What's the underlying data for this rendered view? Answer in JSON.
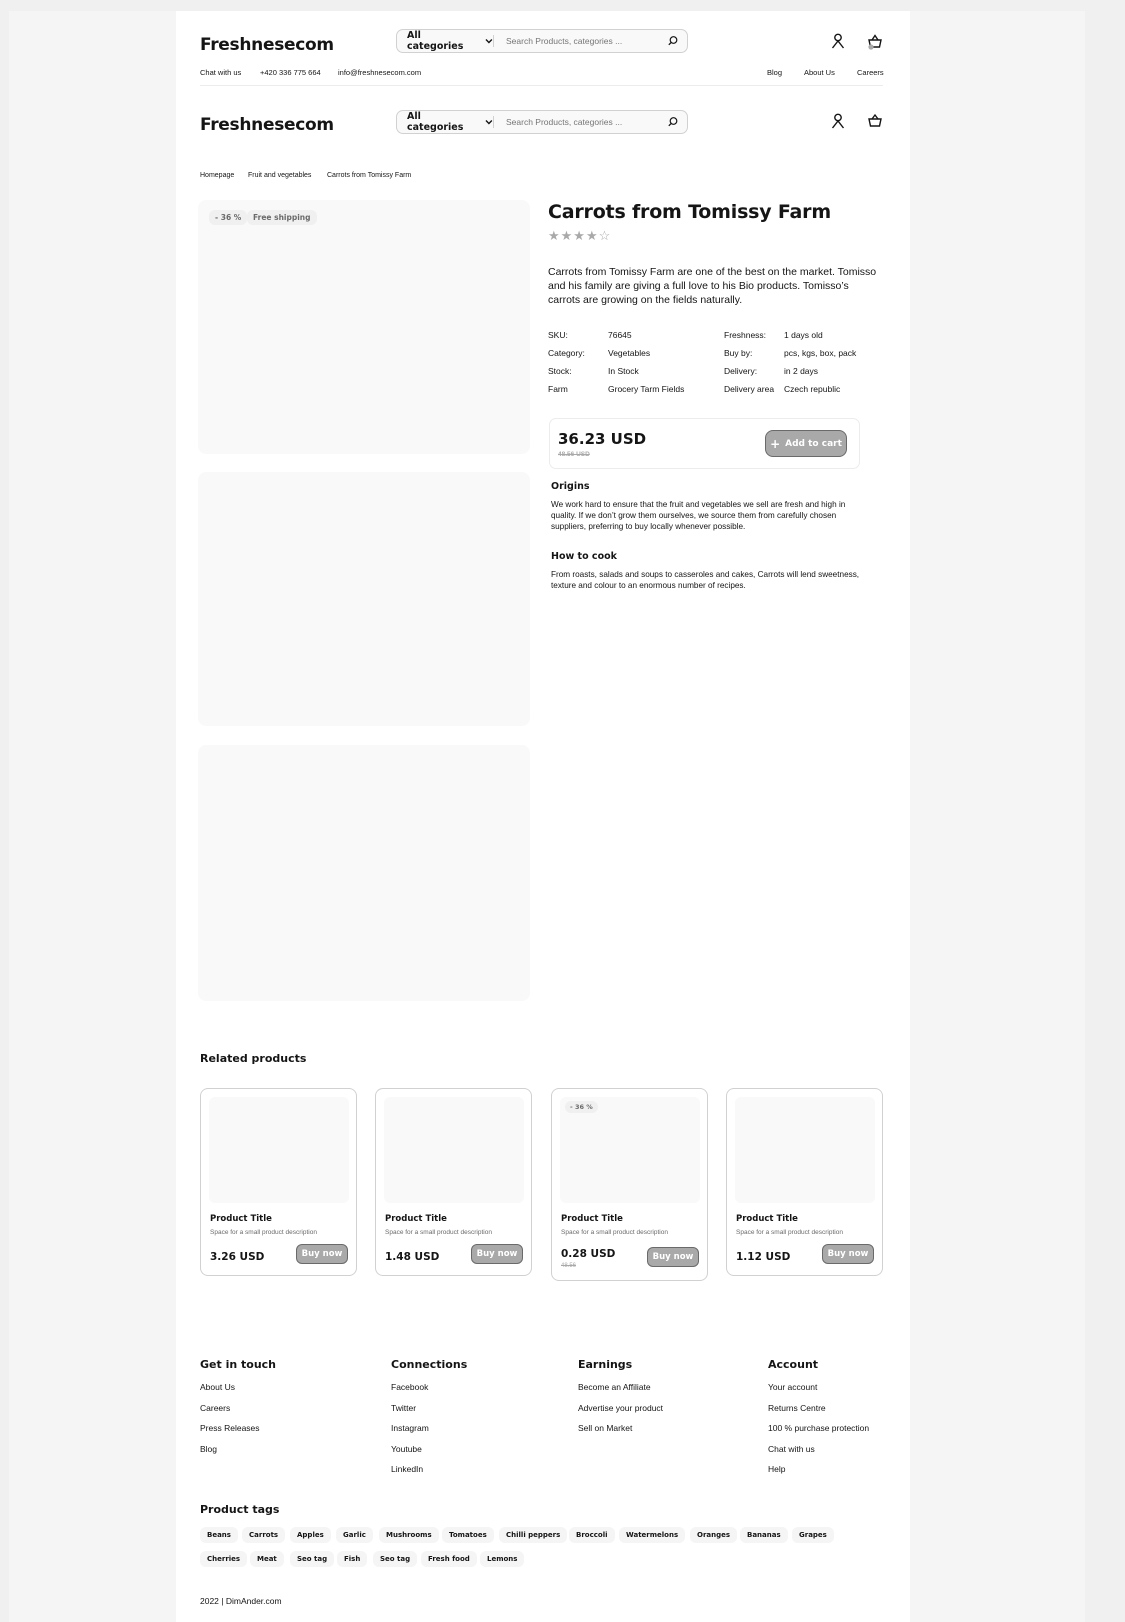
{
  "header": {
    "logo": "Freshnesecom",
    "category_label": "All categories",
    "search_placeholder": "Search Products, categories ...",
    "contact": {
      "chat": "Chat with us",
      "phone": "+420 336 775 664",
      "email": "info@freshnesecom.com"
    },
    "nav": [
      "Blog",
      "About Us",
      "Careers"
    ]
  },
  "breadcrumb": [
    "Homepage",
    "Fruit and vegetables",
    "Carrots from Tomissy Farm"
  ],
  "gallery": {
    "tags": [
      "- 36 %",
      "Free shipping"
    ]
  },
  "product": {
    "title": "Carrots from Tomissy Farm",
    "stars": "★★★★☆",
    "rating": 4,
    "description": "Carrots from Tomissy Farm are one of the best on the market. Tomisso and his family are giving a full love to his Bio products. Tomisso’s carrots are growing on the fields naturally.",
    "specs_left": [
      {
        "label": "SKU:",
        "value": "76645"
      },
      {
        "label": "Category:",
        "value": "Vegetables"
      },
      {
        "label": "Stock:",
        "value": "In Stock"
      },
      {
        "label": "Farm",
        "value": "Grocery Tarm Fields"
      }
    ],
    "specs_right": [
      {
        "label": "Freshness:",
        "value": "1 days old"
      },
      {
        "label": "Buy by:",
        "value": "pcs, kgs, box, pack"
      },
      {
        "label": "Delivery:",
        "value": "in 2 days"
      },
      {
        "label": "Delivery area",
        "value": "Czech republic"
      }
    ],
    "price": "36.23 USD",
    "old_price": "48.56 USD",
    "add_to_cart": "Add to cart",
    "add_icon": "+",
    "origins_title": "Origins",
    "origins_text": "We work hard to ensure that the fruit and vegetables we sell are fresh and high in quality. If we don’t grow them ourselves, we source them from carefully chosen suppliers, preferring to buy locally whenever possible.",
    "cook_title": "How to cook",
    "cook_text": "From roasts, salads and soups to casseroles and cakes, Carrots will lend sweetness, texture and colour to an enormous number of recipes."
  },
  "related": {
    "title": "Related products",
    "items": [
      {
        "title": "Product Title",
        "desc": "Space for a small product description",
        "price": "3.26 USD",
        "old": "",
        "badge": "",
        "button": "Buy now"
      },
      {
        "title": "Product Title",
        "desc": "Space for a small product description",
        "price": "1.48 USD",
        "old": "",
        "badge": "",
        "button": "Buy now"
      },
      {
        "title": "Product Title",
        "desc": "Space for a small product description",
        "price": "0.28 USD",
        "old": "48.56",
        "badge": "- 36 %",
        "button": "Buy now"
      },
      {
        "title": "Product Title",
        "desc": "Space for a small product description",
        "price": "1.12 USD",
        "old": "",
        "badge": "",
        "button": "Buy now"
      }
    ]
  },
  "footer": {
    "columns": [
      {
        "title": "Get in touch",
        "links": [
          "About Us",
          "Careers",
          "Press Releases",
          "Blog"
        ]
      },
      {
        "title": "Connections",
        "links": [
          "Facebook",
          "Twitter",
          "Instagram",
          "Youtube",
          "LinkedIn"
        ]
      },
      {
        "title": "Earnings",
        "links": [
          "Become an Affiliate",
          "Advertise your product",
          "Sell on Market"
        ]
      },
      {
        "title": "Account",
        "links": [
          "Your account",
          "Returns Centre",
          "100 % purchase protection",
          "Chat with us",
          "Help"
        ]
      }
    ],
    "tags_title": "Product tags",
    "tags_row1": [
      "Beans",
      "Carrots",
      "Apples",
      "Garlic",
      "Mushrooms",
      "Tomatoes",
      "Chilli peppers",
      "Broccoli",
      "Watermelons",
      "Oranges",
      "Bananas",
      "Grapes"
    ],
    "tags_row2": [
      "Cherries",
      "Meat",
      "Seo tag",
      "Fish",
      "Seo tag",
      "Fresh food",
      "Lemons"
    ],
    "copyright": "2022 | DimAnder.com"
  },
  "icons": {
    "user": "user-icon",
    "basket": "basket-icon",
    "search": "search-icon",
    "chevron": "chevron-down-icon"
  },
  "colors": {
    "text": "#151515",
    "muted": "#a9a9a9",
    "button": "#a9a9a9",
    "button_border": "#6a6a6a",
    "surface": "#f9f9f9"
  }
}
